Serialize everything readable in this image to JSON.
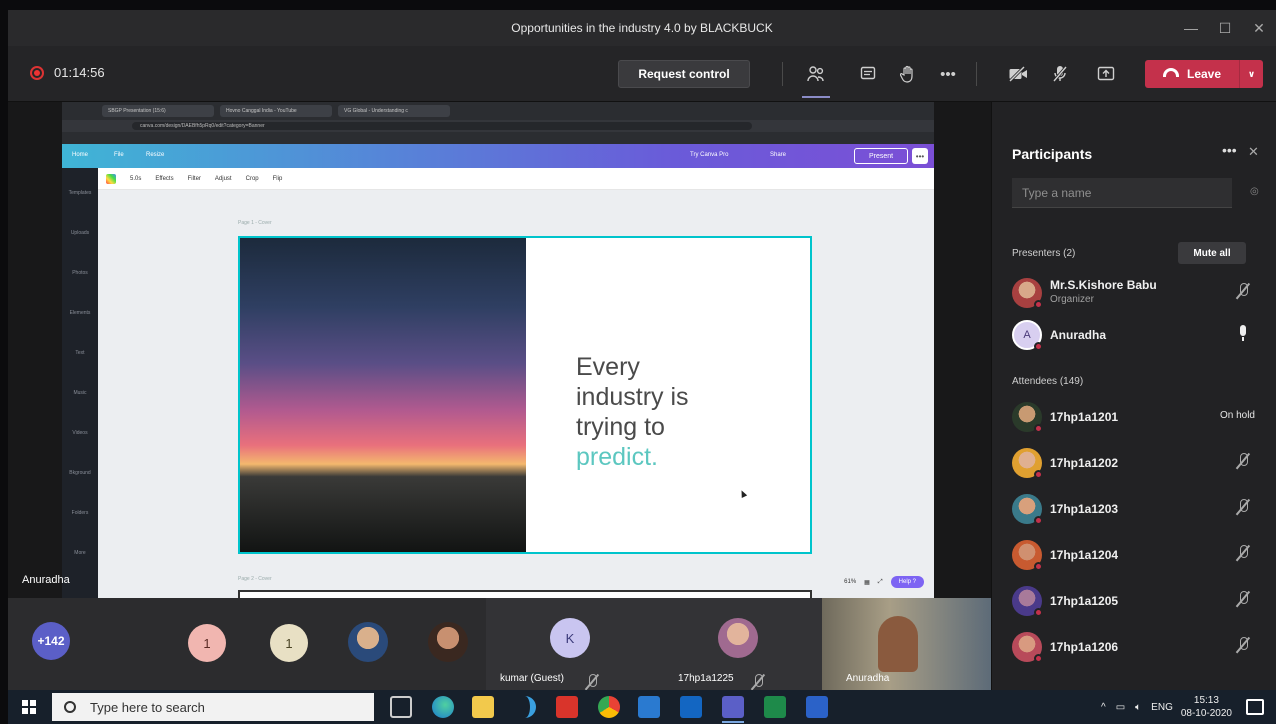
{
  "window": {
    "title": "Opportunities in the industry 4.0 by BLACKBUCK",
    "minimize": "—",
    "maximize": "☐",
    "close": "✕"
  },
  "toolbar": {
    "timer": "01:14:56",
    "request_control": "Request control",
    "more": "•••",
    "leave": "Leave",
    "leave_caret": "∨"
  },
  "browser": {
    "tabs": [
      "SBGP Presentation (15:6)",
      "Hovno Canggal India - YouTube",
      "VG Global - Understanding c"
    ],
    "url": "canva.com/design/DAEBfh5pRq0/edit?category=Banner"
  },
  "canva": {
    "home": "Home",
    "file": "File",
    "resize": "Resize",
    "try_pro": "Try Canva Pro",
    "share": "Share",
    "present": "Present",
    "duration": "5.0s",
    "effects": "Effects",
    "filter": "Filter",
    "adjust": "Adjust",
    "crop": "Crop",
    "flip": "Flip",
    "sidebar": [
      "Templates",
      "Uploads",
      "Photos",
      "Elements",
      "Text",
      "Music",
      "Videos",
      "Bkground",
      "Folders",
      "More"
    ],
    "page1_label": "Page 1 - Cover",
    "page2_label": "Page 2 - Cover",
    "zoom": "61%",
    "help": "Help ?"
  },
  "slide": {
    "line1": "Every",
    "line2": "industry is",
    "line3": "trying to",
    "accent": "predict."
  },
  "stage": {
    "speaker_name": "Anuradha"
  },
  "strip": {
    "overflow_count": "+142",
    "tiles": [
      {
        "initial": "1",
        "color": "#f1b6b0"
      },
      {
        "initial": "1",
        "color": "#e8e0c4"
      },
      {
        "name": "kumar (Guest)",
        "initial": "K",
        "color": "#c9c5f0"
      },
      {
        "name": "17hp1a1225"
      },
      {
        "name": "Anuradha"
      }
    ]
  },
  "participants": {
    "title": "Participants",
    "more": "•••",
    "close": "✕",
    "search_placeholder": "Type a name",
    "presenters_header": "Presenters (2)",
    "mute_all": "Mute all",
    "attendees_header": "Attendees (149)",
    "presenters": [
      {
        "name": "Mr.S.Kishore Babu",
        "role": "Organizer",
        "mic": "off"
      },
      {
        "name": "Anuradha",
        "initial": "A",
        "mic": "on"
      }
    ],
    "attendees": [
      {
        "name": "17hp1a1201",
        "status": "On hold"
      },
      {
        "name": "17hp1a1202",
        "mic": "off"
      },
      {
        "name": "17hp1a1203",
        "mic": "off"
      },
      {
        "name": "17hp1a1204",
        "mic": "off"
      },
      {
        "name": "17hp1a1205",
        "mic": "off"
      },
      {
        "name": "17hp1a1206",
        "mic": "off"
      }
    ]
  },
  "taskbar": {
    "search_placeholder": "Type here to search",
    "language": "ENG",
    "time": "15:13",
    "date": "08-10-2020"
  },
  "colors": {
    "teams_purple": "#5b5fc7",
    "leave_red": "#c4314b",
    "canva_accent": "#00c4cc",
    "slide_accent": "#5cc7c0"
  }
}
